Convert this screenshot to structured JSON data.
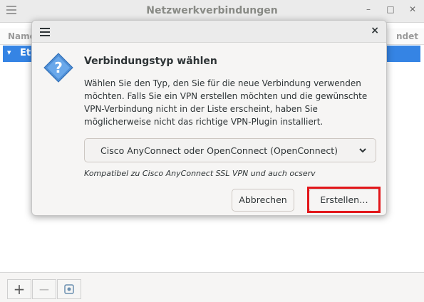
{
  "background_window": {
    "title": "Netzwerkverbindungen",
    "columns": {
      "left": "Name",
      "right": "ndet"
    },
    "selected_row": "Eth",
    "bottom_buttons": {
      "add": "+",
      "remove": "−"
    }
  },
  "dialog": {
    "heading": "Verbindungstyp wählen",
    "description": "Wählen Sie den Typ, den Sie für die neue Verbindung verwenden möchten. Falls Sie ein VPN erstellen möchten und die gewünschte VPN-Verbindung nicht in der Liste erscheint, haben Sie möglicherweise nicht das richtige VPN-Plugin installiert.",
    "selected_type": "Cisco AnyConnect oder OpenConnect (OpenConnect)",
    "hint": "Kompatibel zu Cisco AnyConnect SSL VPN und auch ocserv",
    "cancel_label": "Abbrechen",
    "create_label": "Erstellen…",
    "close_glyph": "×"
  },
  "colors": {
    "accent": "#3584e4",
    "highlight": "#e2161a"
  },
  "icons": {
    "dialog_icon": "question-icon",
    "menu": "hamburger-menu-icon",
    "dropdown": "chevron-down-icon"
  }
}
